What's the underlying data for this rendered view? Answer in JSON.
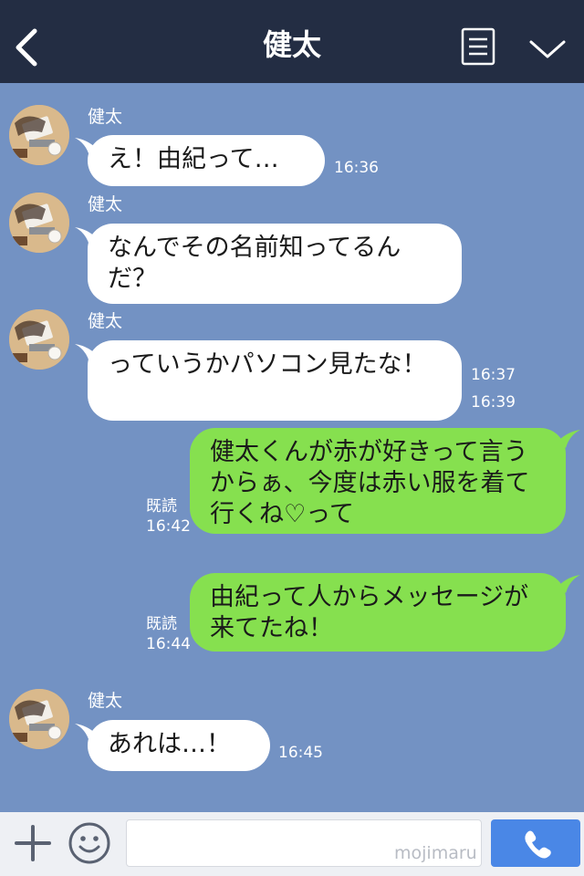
{
  "header": {
    "title": "健太",
    "back_icon": "chevron-left-icon",
    "menu_icon": "document-list-icon",
    "toggle_icon": "chevron-down-icon"
  },
  "messages": [
    {
      "direction": "in",
      "sender": "健太",
      "text": "え！由紀って…",
      "time": "16:36"
    },
    {
      "direction": "in",
      "sender": "健太",
      "text": "なんでその名前知ってるんだ？",
      "time": "16:37"
    },
    {
      "direction": "in",
      "sender": "健太",
      "text": "っていうかパソコン見たな！",
      "time": "16:39"
    },
    {
      "direction": "out",
      "read": "既読",
      "text": "健太くんが赤が好きって言うからぁ、今度は赤い服を着て行くね♡って",
      "time": "16:42"
    },
    {
      "direction": "out",
      "read": "既読",
      "text": "由紀って人からメッセージが来てたね！",
      "time": "16:44"
    },
    {
      "direction": "in",
      "sender": "健太",
      "text": "あれは…！",
      "time": "16:45"
    }
  ],
  "input": {
    "placeholder": "",
    "watermark": "mojimaru"
  },
  "colors": {
    "background": "#7392c3",
    "header": "#232d43",
    "incoming": "#ffffff",
    "outgoing": "#86e04f",
    "send": "#4a87e6"
  }
}
